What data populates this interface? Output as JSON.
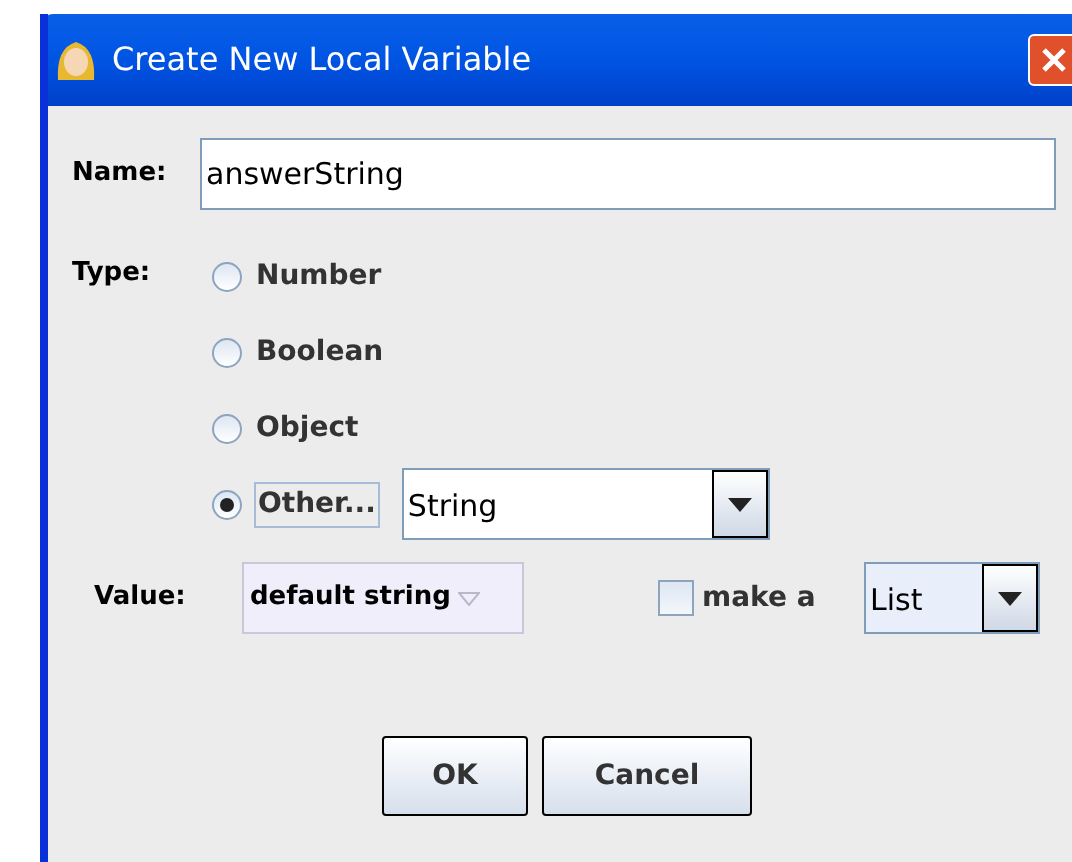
{
  "window": {
    "title": "Create New Local Variable"
  },
  "name": {
    "label": "Name:",
    "value": "answerString"
  },
  "type": {
    "label": "Type:",
    "options": [
      {
        "label": "Number",
        "selected": false,
        "kind": "plain"
      },
      {
        "label": "Boolean",
        "selected": false,
        "kind": "plain"
      },
      {
        "label": "Object",
        "selected": false,
        "kind": "plain"
      },
      {
        "label": "Other...",
        "selected": true,
        "kind": "combo",
        "combo_value": "String"
      }
    ]
  },
  "value": {
    "label": "Value:",
    "button": "default string",
    "make_list": {
      "label": "make a",
      "checked": false
    },
    "list_combo": "List"
  },
  "buttons": [
    "OK",
    "Cancel"
  ]
}
